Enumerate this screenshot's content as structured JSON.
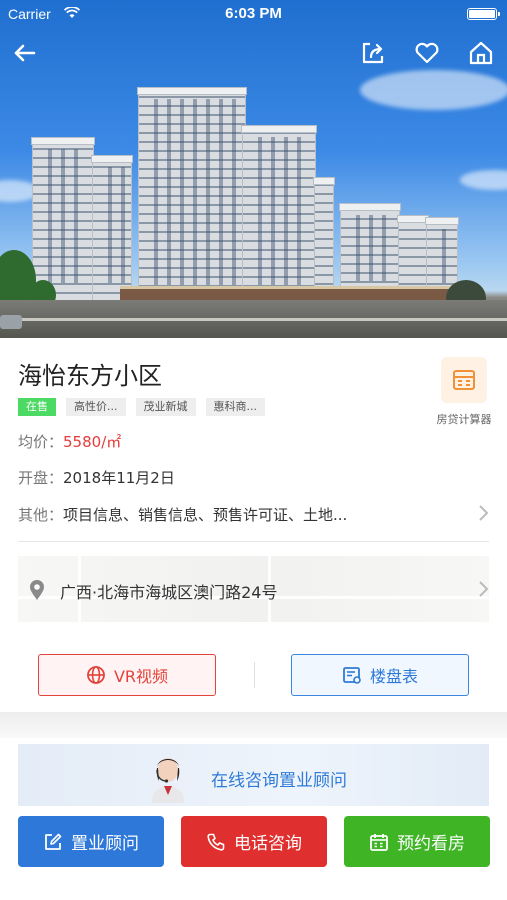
{
  "status_bar": {
    "carrier": "Carrier",
    "time": "6:03 PM"
  },
  "property": {
    "name": "海怡东方小区",
    "tags": [
      "在售",
      "高性价...",
      "茂业新城",
      "惠科商..."
    ],
    "calculator_label": "房贷计算器",
    "price_label": "均价：",
    "price_value": "5580/㎡",
    "opening_label": "开盘：",
    "opening_value": "2018年11月2日",
    "other_label": "其他：",
    "other_value": "项目信息、销售信息、预售许可证、土地...",
    "address": "广西·北海市海城区澳门路24号"
  },
  "actions": {
    "vr": "VR视频",
    "table": "楼盘表"
  },
  "consult_text": "在线咨询置业顾问",
  "bottom_buttons": {
    "advisor": "置业顾问",
    "phone": "电话咨询",
    "visit": "预约看房"
  },
  "colors": {
    "price_red": "#e63b3b",
    "blue": "#2e78d9",
    "red": "#e02f2f",
    "green": "#3fb526",
    "tag_green": "#4cd964"
  },
  "icons": [
    "back-arrow-icon",
    "share-icon",
    "heart-icon",
    "home-icon",
    "calculator-icon",
    "location-pin-icon",
    "chevron-right-icon",
    "globe-icon",
    "building-table-icon",
    "edit-icon",
    "phone-icon",
    "calendar-icon"
  ]
}
